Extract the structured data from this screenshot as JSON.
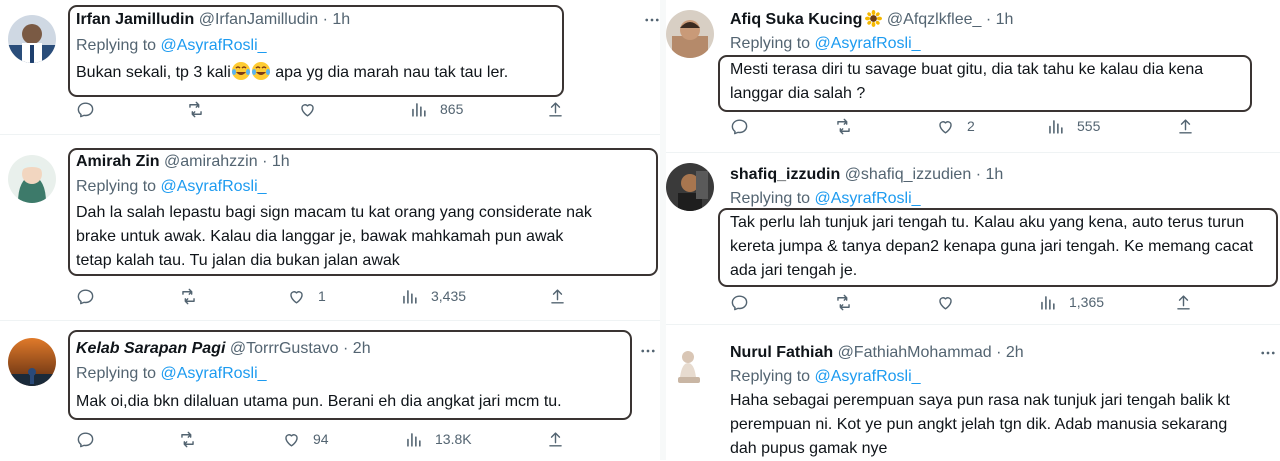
{
  "left_column": {
    "tweets": [
      {
        "name": "Irfan Jamilludin",
        "handle": "@IrfanJamilludin",
        "dot": "·",
        "time": "1h",
        "replying_prefix": "Replying to",
        "replying_to": "@AsyrafRosli_",
        "body_pre": "Bukan sekali, tp 3 kali",
        "body_emojis": [
          "face-with-tears-of-joy",
          "face-with-tears-of-joy"
        ],
        "body_post": " apa yg dia marah nau tak tau ler.",
        "replies": "",
        "retweets": "",
        "likes": "",
        "views": "865"
      },
      {
        "name": "Amirah Zin",
        "handle": "@amirahzzin",
        "dot": "·",
        "time": "1h",
        "replying_prefix": "Replying to",
        "replying_to": "@AsyrafRosli_",
        "body_lines": [
          "Dah la salah lepastu bagi sign macam tu kat orang yang considerate nak",
          "brake untuk awak. Kalau dia langgar je, bawak mahkamah pun awak",
          "tetap kalah tau. Tu jalan dia bukan jalan awak"
        ],
        "replies": "",
        "retweets": "",
        "likes": "1",
        "views": "3,435"
      },
      {
        "name": "Kelab Sarapan Pagi",
        "handle": "@TorrrGustavo",
        "dot": "·",
        "time": "2h",
        "replying_prefix": "Replying to",
        "replying_to": "@AsyrafRosli_",
        "body_lines": [
          "Mak oi,dia bkn dilaluan utama pun. Berani eh dia angkat jari mcm tu."
        ],
        "replies": "",
        "retweets": "",
        "likes": "94",
        "views": "13.8K"
      }
    ]
  },
  "right_column": {
    "tweets": [
      {
        "name": "Afiq Suka Kucing",
        "name_emoji": "sunflower",
        "handle": "@Afqzlkflee_",
        "dot": "·",
        "time": "1h",
        "replying_prefix": "Replying to",
        "replying_to": "@AsyrafRosli_",
        "body_lines": [
          "Mesti terasa diri tu savage buat gitu, dia tak tahu ke kalau dia kena",
          "langgar dia salah ?"
        ],
        "replies": "",
        "retweets": "",
        "likes": "2",
        "views": "555"
      },
      {
        "name": "shafiq_izzudin",
        "handle": "@shafiq_izzudien",
        "dot": "·",
        "time": "1h",
        "replying_prefix": "Replying to",
        "replying_to": "@AsyrafRosli_",
        "body_lines": [
          "Tak perlu lah tunjuk jari tengah tu. Kalau aku yang kena, auto terus turun",
          "kereta jumpa & tanya depan2 kenapa guna jari tengah. Ke memang cacat",
          "ada jari tengah je."
        ],
        "replies": "",
        "retweets": "",
        "likes": "",
        "views": "1,365"
      },
      {
        "name": "Nurul Fathiah",
        "handle": "@FathiahMohammad",
        "dot": "·",
        "time": "2h",
        "replying_prefix": "Replying to",
        "replying_to": "@AsyrafRosli_",
        "body_lines": [
          "Haha sebagai perempuan saya pun rasa nak tunjuk jari tengah balik kt",
          "perempuan ni. Kot ye pun angkt jelah tgn dik. Adab manusia sekarang",
          "dah pupus gamak nye"
        ]
      }
    ]
  },
  "colors": {
    "text_primary": "#0f1419",
    "text_secondary": "#536471",
    "link": "#1d9bf0",
    "highlight_border": "#3a3432",
    "divider": "#eff3f4"
  },
  "icons": {
    "reply": "reply-icon",
    "retweet": "retweet-icon",
    "like": "heart-icon",
    "views": "views-icon",
    "share": "share-icon",
    "more": "more-icon"
  }
}
